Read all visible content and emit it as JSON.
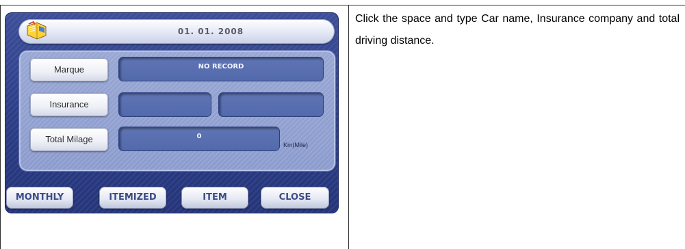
{
  "screen": {
    "date": "01. 01. 2008",
    "rows": {
      "marque": {
        "label": "Marque",
        "value": "NO RECORD"
      },
      "insurance": {
        "label": "Insurance",
        "value_left": "",
        "value_right": ""
      },
      "total_milage": {
        "label": "Total Milage",
        "value": "0",
        "unit": "Km(Mile)"
      }
    },
    "buttons": {
      "monthly": "MONTHLY",
      "itemized": "ITEMIZED",
      "item": "ITEM",
      "close": "CLOSE"
    },
    "icons": {
      "date_icon": "notebook-icon"
    },
    "colors": {
      "screen_background": "#2c3d86",
      "panel_background": "#8b9bcd",
      "field_background": "#5a70b0",
      "button_text": "#3c4a88"
    }
  },
  "instruction": "Click the space and type Car name, Insurance company and total driving distance."
}
